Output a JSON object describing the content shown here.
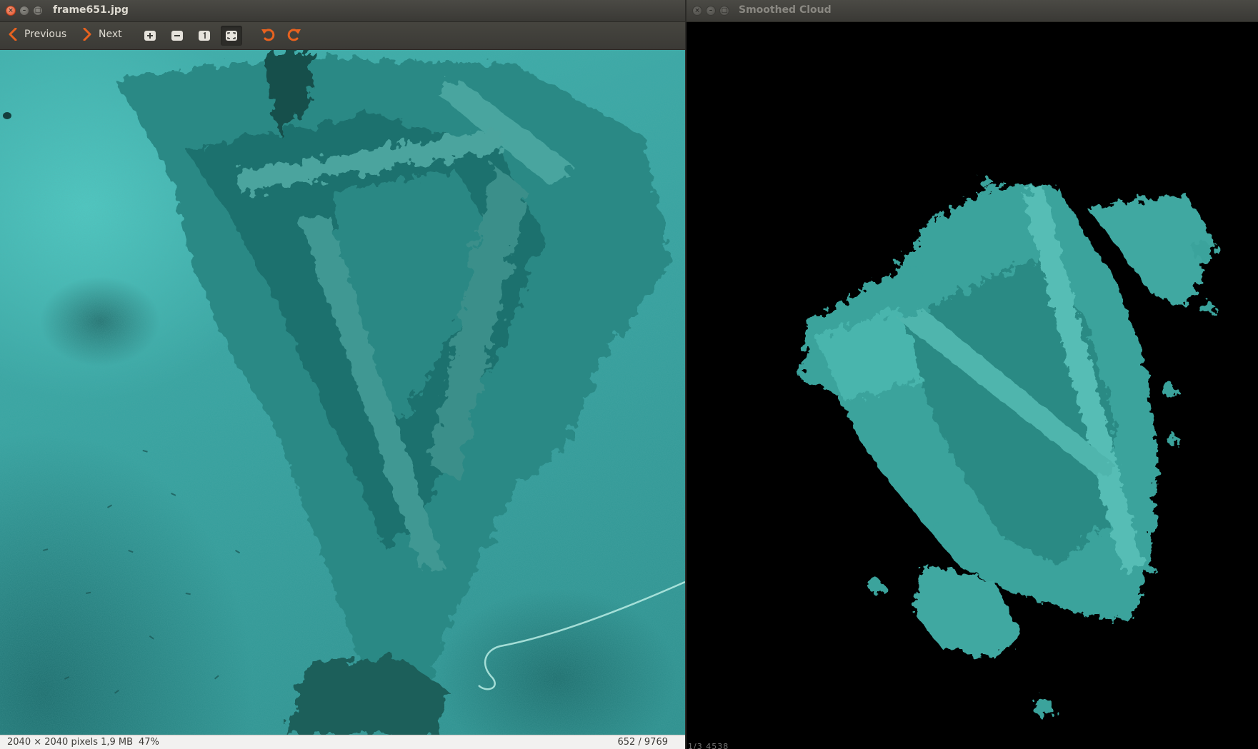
{
  "viewer": {
    "title": "frame651.jpg",
    "toolbar": {
      "previous_label": "Previous",
      "next_label": "Next",
      "icons": [
        "zoom-in-icon",
        "zoom-out-icon",
        "normal-size-icon",
        "best-fit-icon",
        "rotate-left-icon",
        "rotate-right-icon"
      ]
    },
    "status": {
      "info": "2040 × 2040 pixels  1,9 MB",
      "zoom": "47%",
      "count": "652 / 9769"
    },
    "accent_color": "#e8621f"
  },
  "cloud_window": {
    "title": "Smoothed Cloud",
    "status_text": "1/3 4538"
  }
}
